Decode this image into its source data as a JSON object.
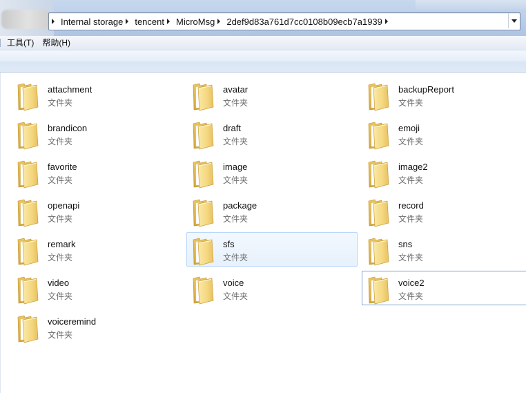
{
  "address_bar": {
    "crumbs": [
      "Internal storage",
      "tencent",
      "MicroMsg",
      "2def9d83a761d7cc0108b09ecb7a1939"
    ]
  },
  "menu": {
    "items": [
      "工具(T)",
      "帮助(H)"
    ]
  },
  "folders": [
    {
      "name": "attachment",
      "type": "文件夹"
    },
    {
      "name": "avatar",
      "type": "文件夹"
    },
    {
      "name": "backupReport",
      "type": "文件夹"
    },
    {
      "name": "brandicon",
      "type": "文件夹"
    },
    {
      "name": "draft",
      "type": "文件夹"
    },
    {
      "name": "emoji",
      "type": "文件夹"
    },
    {
      "name": "favorite",
      "type": "文件夹"
    },
    {
      "name": "image",
      "type": "文件夹"
    },
    {
      "name": "image2",
      "type": "文件夹"
    },
    {
      "name": "openapi",
      "type": "文件夹"
    },
    {
      "name": "package",
      "type": "文件夹"
    },
    {
      "name": "record",
      "type": "文件夹"
    },
    {
      "name": "remark",
      "type": "文件夹"
    },
    {
      "name": "sfs",
      "type": "文件夹"
    },
    {
      "name": "sns",
      "type": "文件夹"
    },
    {
      "name": "video",
      "type": "文件夹"
    },
    {
      "name": "voice",
      "type": "文件夹"
    },
    {
      "name": "voice2",
      "type": "文件夹"
    },
    {
      "name": "voiceremind",
      "type": "文件夹"
    }
  ],
  "state": {
    "hovered_folder": "sfs",
    "focused_folder": "voice2"
  },
  "icons": {
    "folder": "folder-icon",
    "breadcrumb_separator": "chevron-right-icon",
    "address_dropdown": "chevron-down-icon"
  },
  "colors": {
    "hover_fill": "#e7f1fc",
    "hover_border": "#b8d6fb",
    "folder_yellow": "#f2d37a"
  }
}
